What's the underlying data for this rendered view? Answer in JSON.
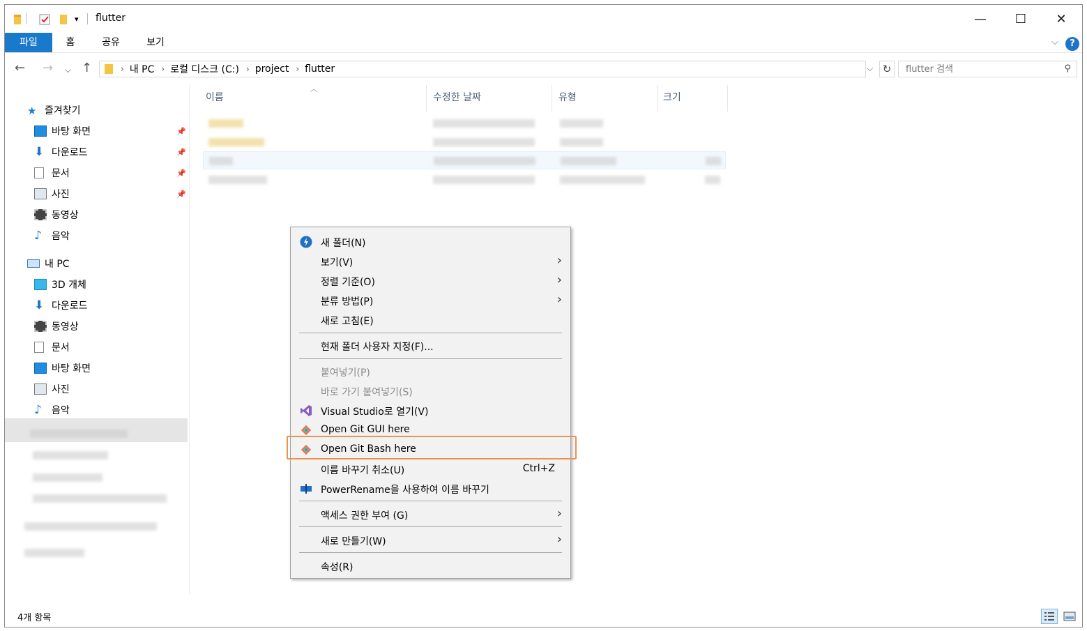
{
  "window": {
    "title": "flutter",
    "controls": {
      "minimize": "—",
      "maximize": "☐",
      "close": "✕"
    }
  },
  "ribbon": {
    "tabs": [
      "파일",
      "홈",
      "공유",
      "보기"
    ],
    "active_tab": "파일",
    "help": "?"
  },
  "address": {
    "crumbs": [
      "내 PC",
      "로컬 디스크 (C:)",
      "project",
      "flutter"
    ],
    "search_placeholder": "flutter 검색"
  },
  "nav": {
    "quick_access": "즐겨찾기",
    "quick_items": [
      "바탕 화면",
      "다운로드",
      "문서",
      "사진",
      "동영상",
      "음악"
    ],
    "this_pc": "내 PC",
    "pc_items": [
      "3D 개체",
      "다운로드",
      "동영상",
      "문서",
      "바탕 화면",
      "사진",
      "음악"
    ]
  },
  "columns": [
    "이름",
    "수정한 날짜",
    "유형",
    "크기"
  ],
  "context_menu": {
    "items": [
      {
        "label": "새 폴더(N)",
        "icon": "new-folder-icon"
      },
      {
        "label": "보기(V)",
        "submenu": true
      },
      {
        "label": "정렬 기준(O)",
        "submenu": true
      },
      {
        "label": "분류 방법(P)",
        "submenu": true
      },
      {
        "label": "새로 고침(E)"
      },
      {
        "label": "현재 폴더 사용자 지정(F)..."
      },
      {
        "label": "붙여넣기(P)",
        "disabled": true
      },
      {
        "label": "바로 가기 붙여넣기(S)",
        "disabled": true
      },
      {
        "label": "Visual Studio로 열기(V)",
        "icon": "visual-studio-icon"
      },
      {
        "label": "Open Git GUI here",
        "icon": "git-icon"
      },
      {
        "label": "Open Git Bash here",
        "icon": "git-icon",
        "highlighted": true
      },
      {
        "label": "이름 바꾸기 취소(U)",
        "shortcut": "Ctrl+Z"
      },
      {
        "label": "PowerRename을 사용하여 이름 바꾸기",
        "icon": "powerrename-icon"
      },
      {
        "label": "액세스 권한 부여 (G)",
        "submenu": true
      },
      {
        "label": "새로 만들기(W)",
        "submenu": true
      },
      {
        "label": "속성(R)"
      }
    ]
  },
  "status": {
    "item_count": "4개 항목"
  },
  "colors": {
    "accent": "#1979ca",
    "highlight_box": "#e8944d",
    "menu_bg": "#f2f2f2"
  }
}
